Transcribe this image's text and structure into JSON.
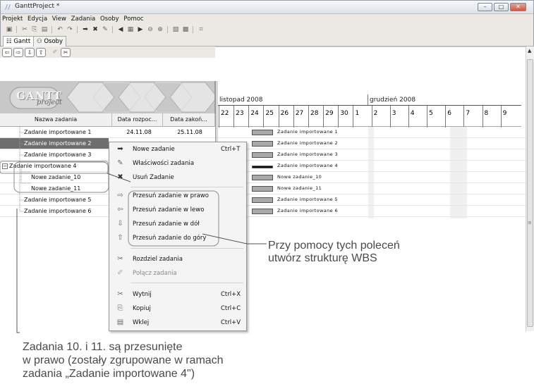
{
  "window": {
    "title": "GanttProject *",
    "controls": [
      "–",
      "□",
      "✕"
    ]
  },
  "menubar": [
    "Projekt",
    "Edycja",
    "View",
    "Zadania",
    "Osoby",
    "Pomoc"
  ],
  "tabs": [
    {
      "label": "Gantt",
      "icon": "gantt-icon",
      "active": true
    },
    {
      "label": "Osoby",
      "icon": "people-icon",
      "active": false
    }
  ],
  "logo": {
    "word1": "GANTT",
    "word2": "project"
  },
  "table": {
    "headers": [
      "Nazwa zadania",
      "Data rozpoc...",
      "Data zakoń..."
    ],
    "rows": [
      {
        "name": "Zadanie importowane 1",
        "start": "24.11.08",
        "end": "25.11.08"
      },
      {
        "name": "Zadanie importowane 2",
        "start": "",
        "end": ""
      },
      {
        "name": "Zadanie importowane 3",
        "start": "",
        "end": ""
      },
      {
        "name": "Zadanie importowane 4",
        "start": "",
        "end": ""
      },
      {
        "name": "Nowe zadanie_10",
        "start": "",
        "end": ""
      },
      {
        "name": "Nowe zadanie_11",
        "start": "",
        "end": ""
      },
      {
        "name": "Zadanie importowane 5",
        "start": "",
        "end": ""
      },
      {
        "name": "Zadanie importowane 6",
        "start": "",
        "end": ""
      }
    ]
  },
  "chart": {
    "months": [
      "listopad 2008",
      "grudzień 2008"
    ],
    "days": [
      "22",
      "23",
      "24",
      "25",
      "26",
      "27",
      "28",
      "29",
      "30",
      "1",
      "2",
      "3",
      "4",
      "5",
      "6",
      "7",
      "8",
      "9"
    ],
    "bars": [
      "Zadanie importowane 1",
      "Zadanie importowane 2",
      "Zadanie importowane 3",
      "Zadanie importowane 4",
      "Nowe zadanie_10",
      "Nowe zadanie_11",
      "Zadanie importowane 5",
      "Zadanie importowane 6"
    ]
  },
  "context_menu": {
    "items": [
      {
        "label": "Nowe zadanie",
        "shortcut": "Ctrl+T",
        "icon": "new-task-icon"
      },
      {
        "label": "Właściwości zadania",
        "shortcut": "",
        "icon": "properties-icon"
      },
      {
        "label": "Usuń Zadanie",
        "shortcut": "",
        "icon": "delete-icon"
      },
      {
        "label": "Przesuń zadanie w prawo",
        "shortcut": "",
        "icon": "arrow-right-icon"
      },
      {
        "label": "Przesuń zadanie w lewo",
        "shortcut": "",
        "icon": "arrow-left-icon"
      },
      {
        "label": "Przesuń zadanie w dół",
        "shortcut": "",
        "icon": "arrow-down-icon"
      },
      {
        "label": "Przesuń zadanie do góry",
        "shortcut": "",
        "icon": "arrow-up-icon"
      },
      {
        "label": "Rozdziel zadania",
        "shortcut": "",
        "icon": "unlink-icon"
      },
      {
        "label": "Połącz zadania",
        "shortcut": "",
        "icon": "link-icon",
        "disabled": true
      },
      {
        "label": "Wytnij",
        "shortcut": "Ctrl+X",
        "icon": "scissors-icon"
      },
      {
        "label": "Kopiuj",
        "shortcut": "Ctrl+C",
        "icon": "copy-icon"
      },
      {
        "label": "Wklej",
        "shortcut": "Ctrl+V",
        "icon": "paste-icon"
      }
    ]
  },
  "annotations": {
    "wbs": [
      "Przy pomocy tych poleceń",
      "utwórz strukturę WBS"
    ],
    "moved": [
      "Zadania 10. i 11. są przesunięte",
      "w prawo (zostały zgrupowane w ramach",
      "zadania „Zadanie importowane 4\")"
    ]
  }
}
